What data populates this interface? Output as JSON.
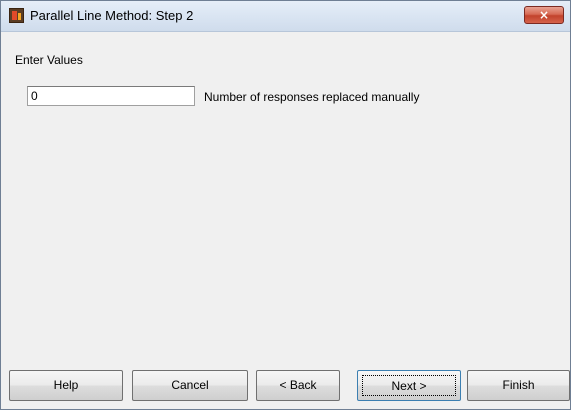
{
  "window": {
    "title": "Parallel Line Method: Step 2",
    "close_label": "×"
  },
  "form": {
    "group_label": "Enter Values",
    "responses_value": "0",
    "responses_label": "Number of responses replaced manually"
  },
  "buttons": {
    "help": "Help",
    "cancel": "Cancel",
    "back": "< Back",
    "next": "Next >",
    "finish": "Finish"
  },
  "icons": {
    "app": "app-logo-icon",
    "close": "close-icon"
  }
}
